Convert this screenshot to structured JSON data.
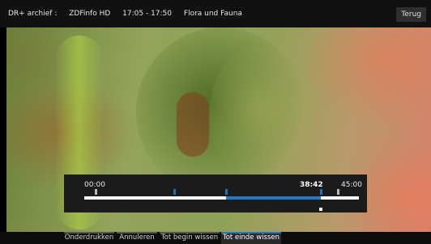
{
  "header": {
    "source": "DR+ archief :",
    "channel": "ZDFinfo HD",
    "time": "17:05 - 17:50",
    "program": "Flora und Fauna",
    "back_label": "Terug"
  },
  "timeline": {
    "start_label": "00:00",
    "current_label": "38:42",
    "end_label": "45:00",
    "progress": 0.86
  },
  "actions": [
    {
      "label": "Onderdrukken"
    },
    {
      "label": "Annuleren"
    },
    {
      "label": "Tot begin wissen"
    },
    {
      "label": "Tot einde wissen"
    }
  ],
  "colors": {
    "accent": "#2179c8",
    "bar": "#1b1b1b"
  }
}
